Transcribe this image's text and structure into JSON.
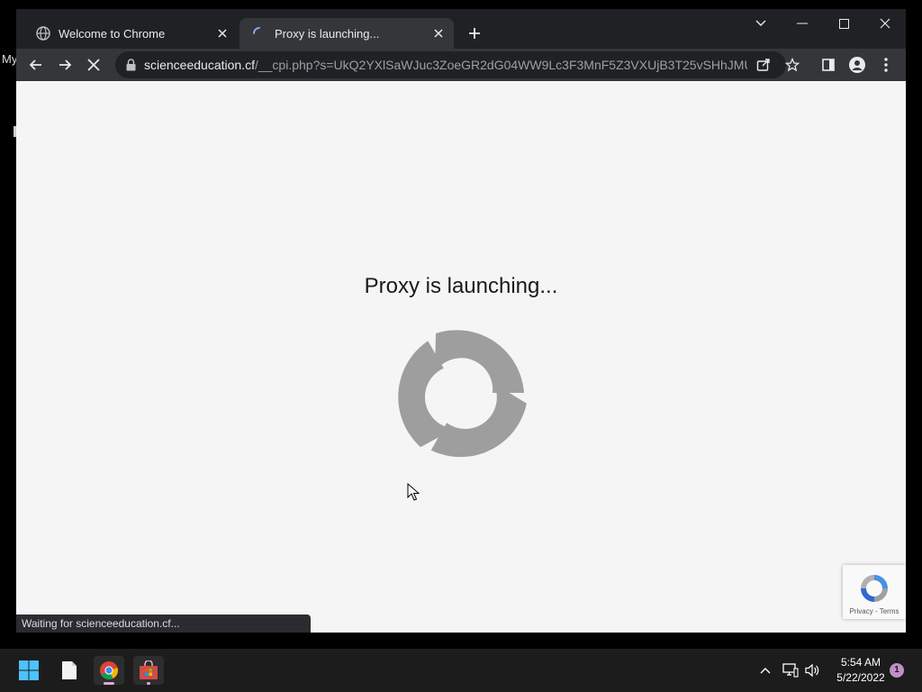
{
  "desktop": {
    "partial_label": "My"
  },
  "tabs": [
    {
      "title": "Welcome to Chrome",
      "favicon": "globe-icon",
      "active": false
    },
    {
      "title": "Proxy is launching...",
      "favicon": "loading-spinner-icon",
      "active": true
    }
  ],
  "omnibox": {
    "host": "scienceeducation.cf",
    "path": "/__cpi.php?s=UkQ2YXlSaWJuc3ZoeGR2dG04WW9Lc3F3MnF5Z3VXUjB3T25vSHhJMU9s..."
  },
  "page": {
    "headline": "Proxy is launching..."
  },
  "status_bar": {
    "text": "Waiting for scienceeducation.cf..."
  },
  "recaptcha": {
    "privacy": "Privacy",
    "separator": " - ",
    "terms": "Terms"
  },
  "taskbar": {
    "clock_time": "5:54 AM",
    "clock_date": "5/22/2022",
    "notification_count": "1"
  },
  "colors": {
    "spinner": "#9e9e9e",
    "accent": "#1a73e8"
  }
}
